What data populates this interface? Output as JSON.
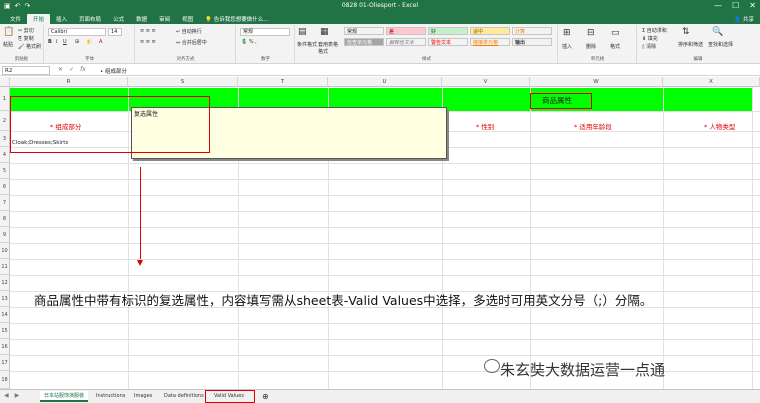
{
  "window": {
    "title": "0828 01-Oliesport - Excel",
    "min": "—",
    "max": "☐",
    "close": "✕"
  },
  "ribbon_tabs": [
    "文件",
    "开始",
    "插入",
    "页面布局",
    "公式",
    "数据",
    "审阅",
    "视图"
  ],
  "tell_me": "告诉我您想要做什么...",
  "share": "共享",
  "ribbon": {
    "clipboard": {
      "paste": "粘贴",
      "cut": "剪切",
      "copy": "复制",
      "format_painter": "格式刷",
      "label": "剪贴板"
    },
    "font": {
      "name": "Calibri",
      "size": "14",
      "label": "字体"
    },
    "alignment": {
      "wrap": "自动换行",
      "merge": "合并后居中",
      "label": "对齐方式"
    },
    "number": {
      "format": "常规",
      "label": "数字"
    },
    "styles": {
      "conditional": "条件格式",
      "table": "套用表格格式",
      "cells": [
        {
          "text": "常规",
          "bg": "#ffffff",
          "color": "#000000"
        },
        {
          "text": "差",
          "bg": "#ffc7ce",
          "color": "#9c0006"
        },
        {
          "text": "好",
          "bg": "#c6efce",
          "color": "#006100"
        },
        {
          "text": "适中",
          "bg": "#ffeb9c",
          "color": "#9c5700"
        },
        {
          "text": "计算",
          "bg": "#f2f2f2",
          "color": "#fa7d00"
        },
        {
          "text": "检查单元格",
          "bg": "#a5a5a5",
          "color": "#ffffff"
        },
        {
          "text": "解释性文本",
          "bg": "#ffffff",
          "color": "#7f7f7f"
        },
        {
          "text": "警告文本",
          "bg": "#ffffff",
          "color": "#ff0000"
        },
        {
          "text": "链接单元格",
          "bg": "#ffffff",
          "color": "#fa7d00"
        },
        {
          "text": "输出",
          "bg": "#f2f2f2",
          "color": "#3f3f3f"
        }
      ],
      "label": "样式"
    },
    "cells_group": {
      "insert": "插入",
      "delete": "删除",
      "format": "格式",
      "label": "单元格"
    },
    "editing": {
      "autosum": "自动求和",
      "fill": "填充",
      "clear": "清除",
      "sort": "排序和筛选",
      "find": "查找和选择",
      "label": "编辑"
    }
  },
  "formula_bar": {
    "name_box": "R2",
    "content": "• 组成部分"
  },
  "columns": [
    "R",
    "S",
    "T",
    "U",
    "V",
    "W",
    "X"
  ],
  "rows": [
    "1",
    "2",
    "3",
    "4",
    "5",
    "6",
    "7",
    "8",
    "9",
    "10",
    "11",
    "12",
    "13",
    "14",
    "15",
    "16",
    "17",
    "18"
  ],
  "cells": {
    "header_merged": "商品属性",
    "r2_R": "* 组成部分",
    "r2_V": "* 性别",
    "r2_W": "* 适用年龄段",
    "r2_X": "* 人物类型",
    "r3_R": "Cloak;Dresses;Skirts"
  },
  "comment_text": "复选属性",
  "caption": "商品属性中带有标识的复选属性，内容填写需从sheet表-Valid Values中选择，多选时可用英文分号（;）分隔。",
  "watermark": "朱玄奘大数据运营一点通",
  "sheet_tabs": [
    "日本站服饰演服装",
    "Instructions",
    "Images",
    "Data definitions",
    "Valid Values"
  ],
  "active_sheet": "日本站服饰演服装",
  "colors": {
    "excel_green": "#217346",
    "header_fill": "#00ff00",
    "annotation_red": "#e00000"
  }
}
